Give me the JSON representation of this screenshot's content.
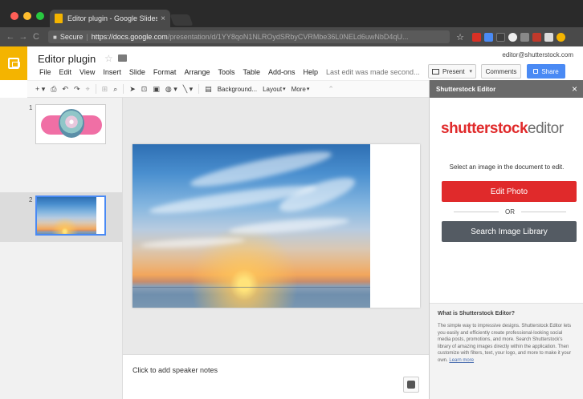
{
  "browser": {
    "tab_title": "Editor plugin - Google Slides",
    "tab_close": "×",
    "secure_label": "Secure",
    "url_host": "https://docs.google.com",
    "url_path": "/presentation/d/1YY8qoN1NLROydSRbyCVRMbe36L0NELd6uwNbD4qU...",
    "star": "☆",
    "separator": "|"
  },
  "header": {
    "doc_title": "Editor plugin",
    "star": "☆",
    "user_email": "editor@shutterstock.com",
    "menu": [
      "File",
      "Edit",
      "View",
      "Insert",
      "Slide",
      "Format",
      "Arrange",
      "Tools",
      "Table",
      "Add-ons",
      "Help"
    ],
    "last_edit": "Last edit was made second...",
    "present_label": "Present",
    "comments_label": "Comments",
    "share_label": "Share"
  },
  "toolbar": {
    "background_label": "Background...",
    "layout_label": "Layout",
    "more_label": "More"
  },
  "filmstrip": {
    "slides": [
      {
        "number": "1"
      },
      {
        "number": "2"
      }
    ]
  },
  "notes": {
    "placeholder": "Click to add speaker notes"
  },
  "panel": {
    "title": "Shutterstock Editor",
    "close": "×",
    "brand_main": "shutterstock",
    "brand_sub": "editor",
    "hint": "Select an image in the document to edit.",
    "edit_photo_label": "Edit Photo",
    "or_label": "OR",
    "search_label": "Search Image Library",
    "about_title": "What is Shutterstock Editor?",
    "about_body": "The simple way to impressive designs. Shutterstock Editor lets you easily and efficiently create professional-looking social media posts, promotions, and more. Search Shutterstock's library of amazing images directly within the application. Then customize with filters, text, your logo, and more to make it your own.",
    "about_link": "Learn more"
  },
  "colors": {
    "slides_yellow": "#f4b400",
    "share_blue": "#4a8af4",
    "brand_red": "#e02a2b",
    "search_gray": "#545b63"
  }
}
